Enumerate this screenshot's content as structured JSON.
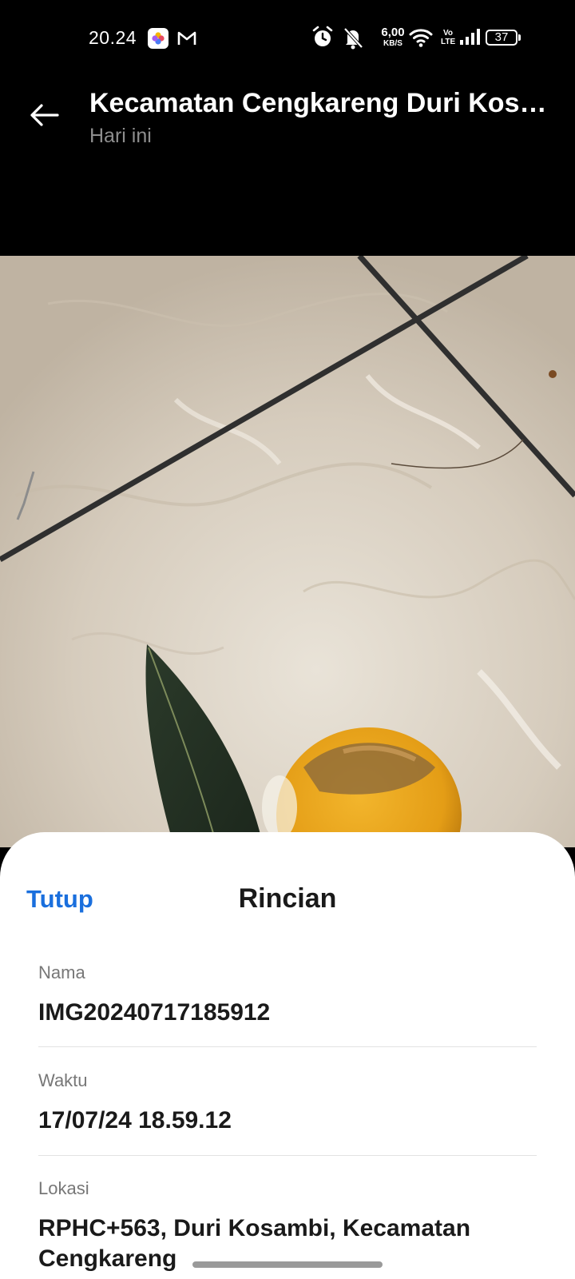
{
  "status_bar": {
    "time": "20.24",
    "network_speed_value": "6,00",
    "network_speed_unit": "KB/S",
    "volte_top": "Vo",
    "volte_bottom": "LTE",
    "battery_level": "37",
    "icons": [
      "app-icon",
      "gmail-icon",
      "alarm-icon",
      "mute-icon",
      "wifi-icon",
      "signal-icon",
      "battery-icon"
    ]
  },
  "header": {
    "title": "Kecamatan Cengkareng Duri Kosambi",
    "subtitle": "Hari ini",
    "back_icon": "back-arrow-icon"
  },
  "details": {
    "close_label": "Tutup",
    "title": "Rincian",
    "fields": [
      {
        "label": "Nama",
        "value": "IMG20240717185912"
      },
      {
        "label": "Waktu",
        "value": "17/07/24 18.59.12"
      },
      {
        "label": "Lokasi",
        "value": "RPHC+563, Duri Kosambi, Kecamatan Cengkareng"
      }
    ]
  },
  "colors": {
    "accent": "#1a6fdd",
    "background_dark": "#000000",
    "sheet": "#ffffff"
  }
}
